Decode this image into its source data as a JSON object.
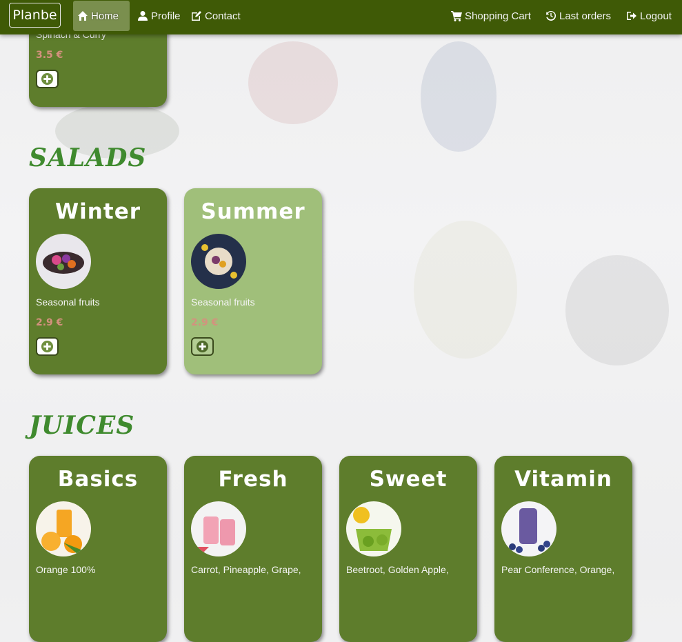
{
  "navbar": {
    "brand": "Planbe",
    "left_items": [
      {
        "label": "Home",
        "icon": "home-icon",
        "active": true
      },
      {
        "label": "Profile",
        "icon": "user-icon"
      },
      {
        "label": "Contact",
        "icon": "edit-icon"
      }
    ],
    "right_items": [
      {
        "label": "Shopping Cart",
        "icon": "cart-icon"
      },
      {
        "label": "Last orders",
        "icon": "history-icon"
      },
      {
        "label": "Logout",
        "icon": "logout-icon"
      }
    ]
  },
  "top_card": {
    "desc": "Spinach & Curry",
    "price": "3.5 €"
  },
  "sections": {
    "salads": {
      "title": "SALADS",
      "cards": [
        {
          "title": "Winter",
          "desc": "Seasonal fruits",
          "price": "2.9 €"
        },
        {
          "title": "Summer",
          "desc": "Seasonal fruits",
          "price": "2.9 €"
        }
      ]
    },
    "juices": {
      "title": "JUICES",
      "cards": [
        {
          "title": "Basics",
          "desc": "Orange 100%"
        },
        {
          "title": "Fresh",
          "desc": "Carrot, Pineapple, Grape,"
        },
        {
          "title": "Sweet",
          "desc": "Beetroot, Golden Apple,"
        },
        {
          "title": "Vitamin",
          "desc": "Pear Conference, Orange,"
        }
      ]
    }
  },
  "colors": {
    "nav_bg": "#3f5a06",
    "card_bg": "#5e7d2c",
    "card_light_bg": "#a0bf7a",
    "heading": "#3f8a2e",
    "price": "#d4917e"
  }
}
